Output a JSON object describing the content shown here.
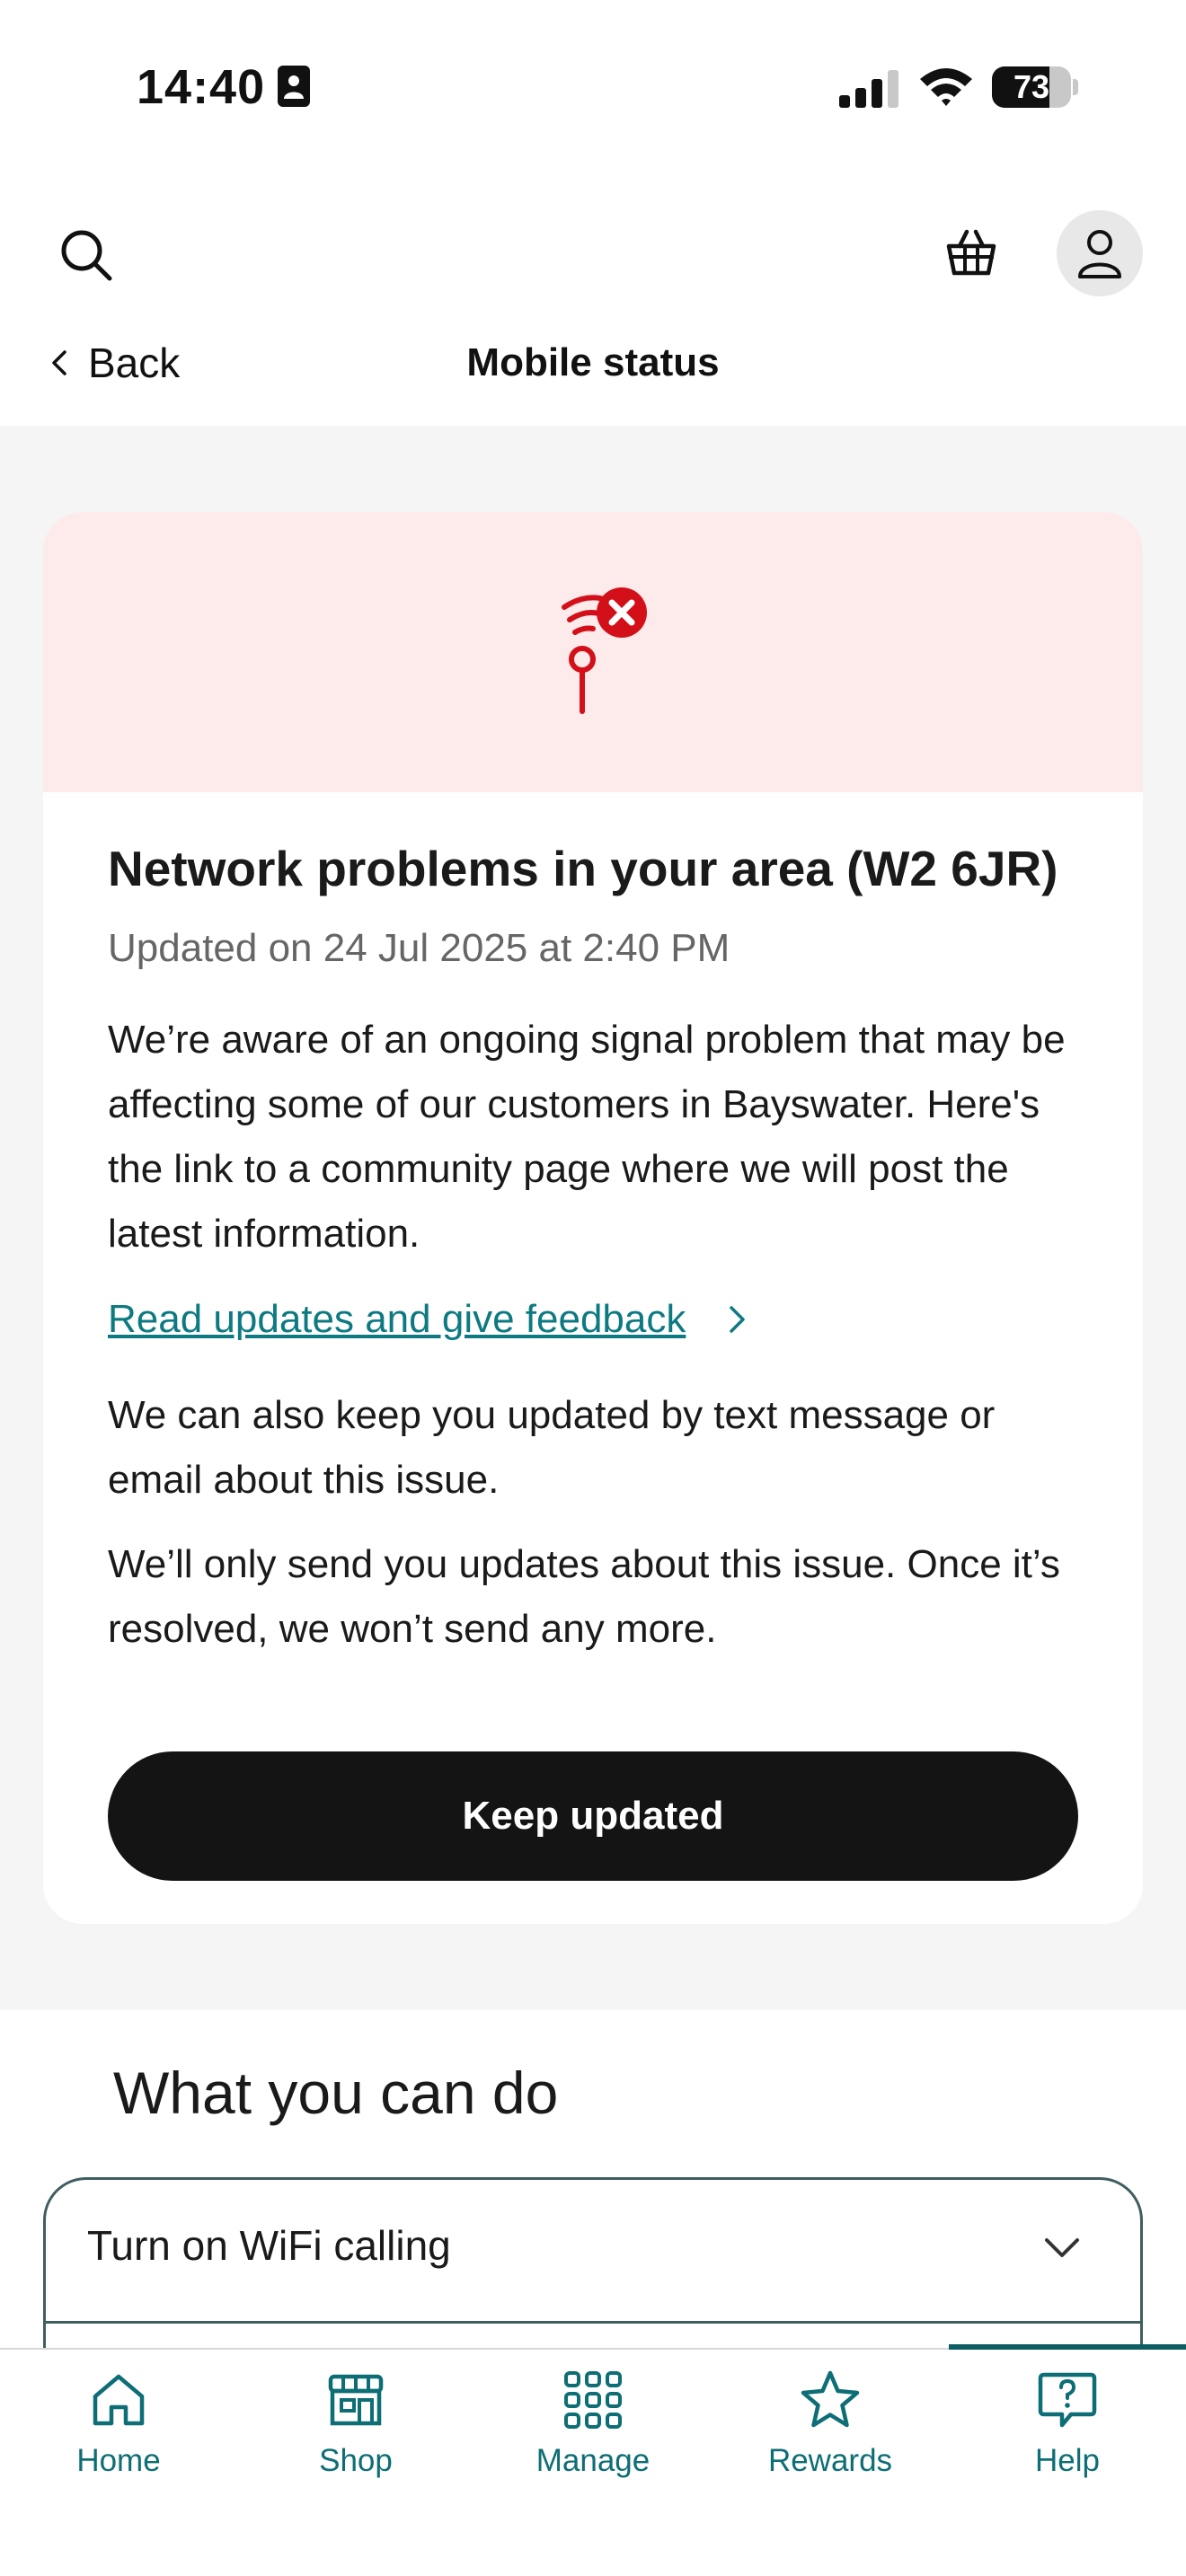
{
  "status_bar": {
    "time": "14:40",
    "battery_level": "73",
    "battery_fraction": 0.73
  },
  "header": {
    "back_label": "Back",
    "title": "Mobile status"
  },
  "alert": {
    "title": "Network problems in your area (W2 6JR)",
    "updated": "Updated on 24 Jul 2025 at 2:40 PM",
    "paragraph1": "We’re aware of an ongoing signal problem that may be affecting some of our customers in Bayswater. Here's the link to a community page where we will post the latest information.",
    "link_label": "Read updates and give feedback",
    "paragraph2": "We can also keep you updated by text message or email about this issue.",
    "paragraph3": "We’ll only send you updates about this issue. Once it’s resolved, we won’t send any more.",
    "button_label": "Keep updated",
    "colors": {
      "banner_bg": "#fdeaea",
      "error_red": "#d3101a",
      "link_teal": "#0d7a82"
    }
  },
  "actions": {
    "title": "What you can do",
    "items": [
      {
        "label": "Turn on WiFi calling"
      }
    ]
  },
  "bottom_nav": {
    "active": "Help",
    "items": [
      {
        "label": "Home",
        "icon": "home-icon"
      },
      {
        "label": "Shop",
        "icon": "shop-icon"
      },
      {
        "label": "Manage",
        "icon": "grid-icon"
      },
      {
        "label": "Rewards",
        "icon": "star-icon"
      },
      {
        "label": "Help",
        "icon": "help-icon"
      }
    ]
  }
}
